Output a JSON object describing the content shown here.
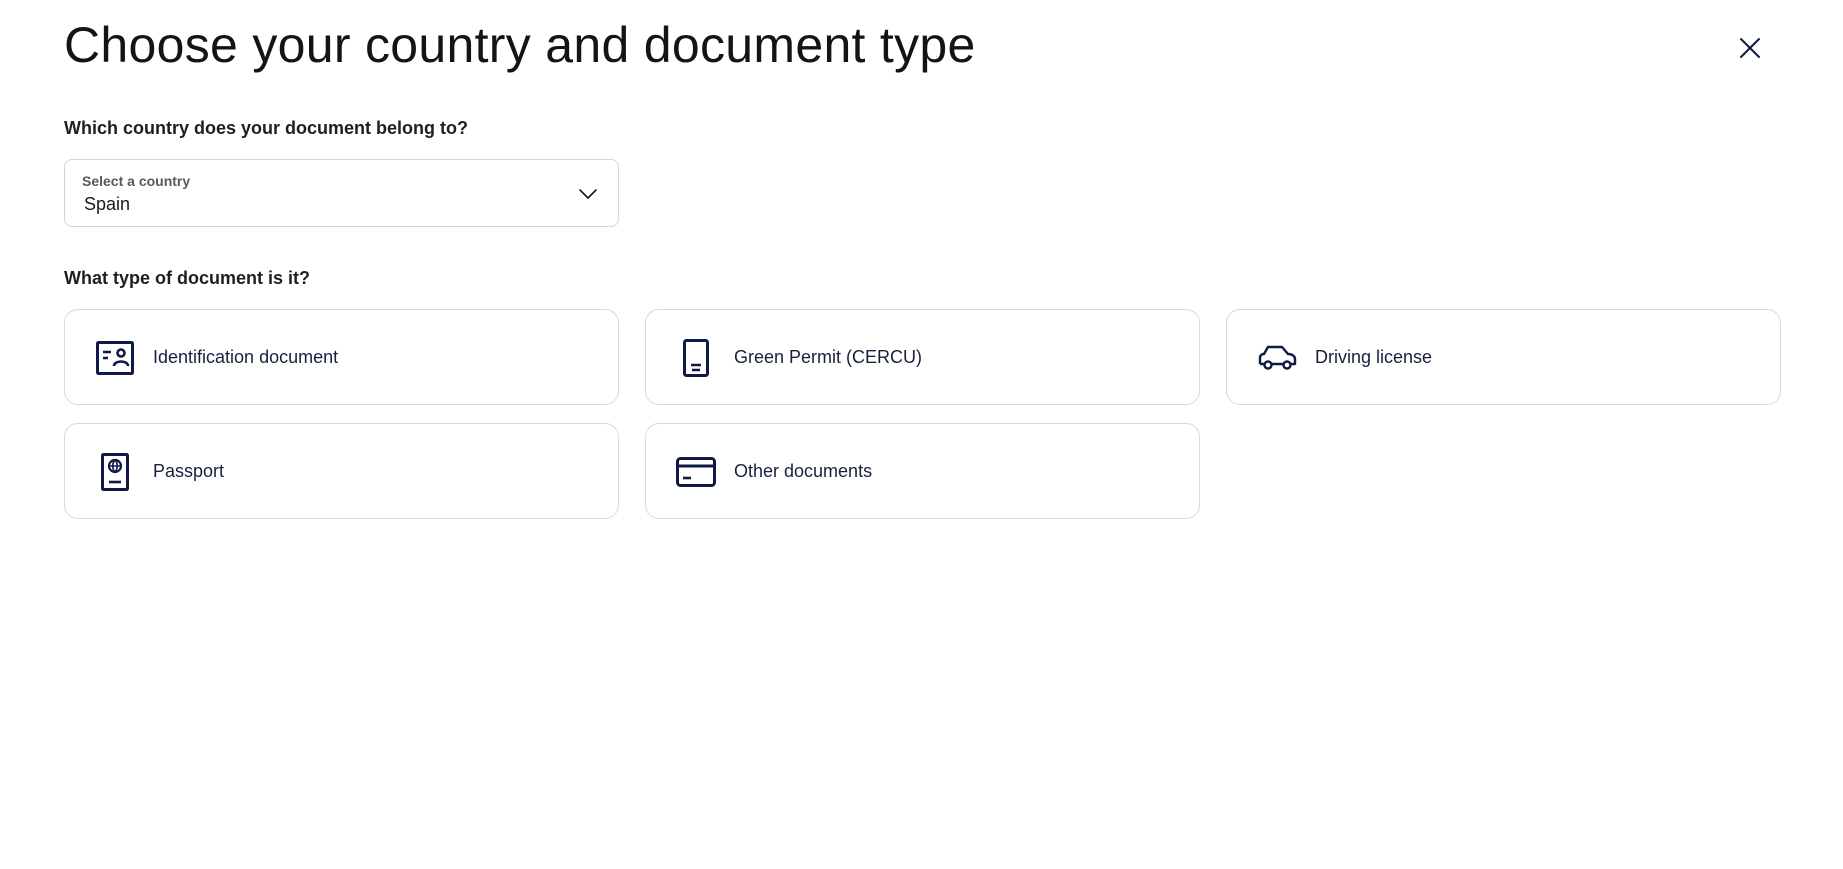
{
  "header": {
    "title": "Choose your country and document type"
  },
  "country": {
    "question": "Which country does your document belong to?",
    "select_label": "Select a country",
    "selected_value": "Spain"
  },
  "document": {
    "question": "What type of document is it?",
    "options": [
      {
        "label": "Identification document",
        "icon": "id-card-icon"
      },
      {
        "label": "Green Permit (CERCU)",
        "icon": "phone-document-icon"
      },
      {
        "label": "Driving license",
        "icon": "car-icon"
      },
      {
        "label": "Passport",
        "icon": "passport-icon"
      },
      {
        "label": "Other documents",
        "icon": "credit-card-icon"
      }
    ]
  },
  "colors": {
    "icon": "#0e1a45",
    "border": "#d9d9de"
  }
}
